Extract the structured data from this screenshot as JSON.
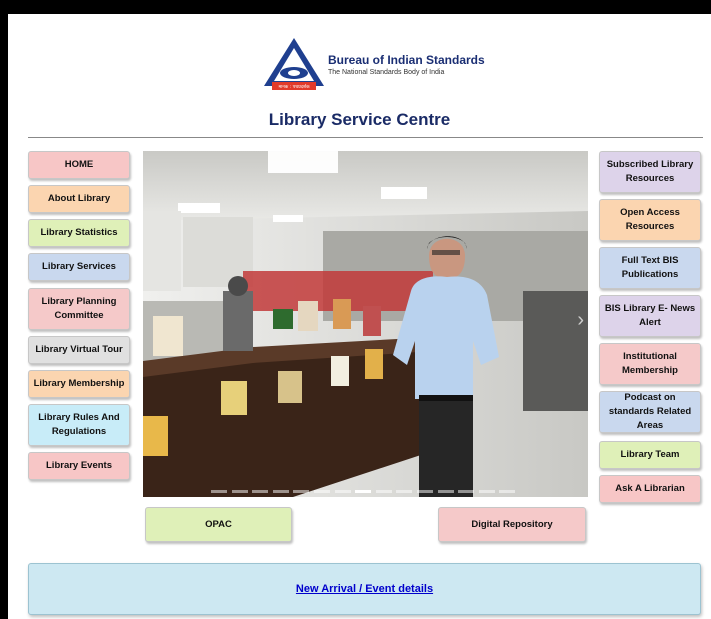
{
  "header": {
    "org_name": "Bureau of Indian Standards",
    "org_tagline": "The National Standards Body of India",
    "logo_caption": "मानक : पथप्रदर्शक",
    "page_title": "Library Service Centre"
  },
  "left_menu": [
    {
      "label": "HOME",
      "color": "#f7c6c6"
    },
    {
      "label": "About Library",
      "color": "#fbd5b0"
    },
    {
      "label": "Library Statistics",
      "color": "#dff0b8"
    },
    {
      "label": "Library Services",
      "color": "#c9d8ee"
    },
    {
      "label": "Library Planning Committee",
      "color": "#f5c9c9"
    },
    {
      "label": "Library Virtual Tour",
      "color": "#e0e0e0"
    },
    {
      "label": "Library Membership",
      "color": "#fbd5b0"
    },
    {
      "label": "Library Rules And Regulations",
      "color": "#c8ecf8"
    },
    {
      "label": "Library Events",
      "color": "#f7c6c6"
    }
  ],
  "right_menu": [
    {
      "label": "Subscribed Library Resources",
      "color": "#ddd3ea"
    },
    {
      "label": "Open Access Resources",
      "color": "#fbd5b0"
    },
    {
      "label": "Full Text BIS Publications",
      "color": "#c9d8ee"
    },
    {
      "label": "BIS Library E- News Alert",
      "color": "#ddd3ea"
    },
    {
      "label": "Institutional Membership",
      "color": "#f5c9c9"
    },
    {
      "label": "Podcast on standards Related Areas",
      "color": "#c9d8ee"
    },
    {
      "label": "Library Team",
      "color": "#dff0b8"
    },
    {
      "label": "Ask A Librarian",
      "color": "#f7c6c6"
    }
  ],
  "carousel": {
    "slide_count": 15,
    "active_slide": 7
  },
  "bottom_buttons": {
    "opac": {
      "label": "OPAC",
      "color": "#dff0b8"
    },
    "digital_repository": {
      "label": "Digital Repository",
      "color": "#f5c9c9"
    }
  },
  "banner": {
    "link_text": "New Arrival / Event details"
  }
}
